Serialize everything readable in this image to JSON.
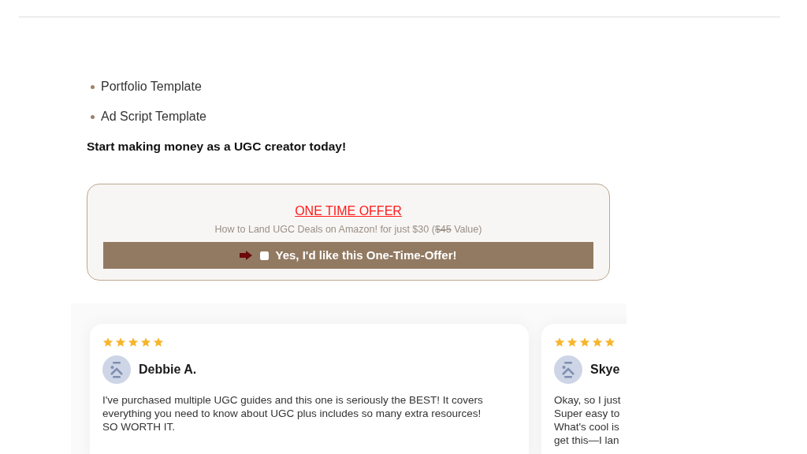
{
  "list_items": [
    "Portfolio Template",
    "Ad Script Template"
  ],
  "heading": "Start making money as a UGC creator today!",
  "offer": {
    "title": "ONE TIME OFFER",
    "subtitle": "How to Land UGC Deals on Amazon! for just $30 (",
    "old_price": "$45",
    "subtitle_end": " Value)",
    "checkbox_label": "Yes, I'd like this One-Time-Offer!",
    "checked": false
  },
  "reviews": [
    {
      "stars": 5,
      "name": "Debbie A.",
      "text": "I've purchased multiple UGC guides and this one is seriously the BEST! It covers everything you need to know about UGC plus includes so many extra resources! SO WORTH IT."
    },
    {
      "stars": 5,
      "name": "Skye",
      "lines": [
        "Okay, so I just",
        "Super easy to",
        "What's cool is",
        "get this—I lan"
      ]
    }
  ]
}
